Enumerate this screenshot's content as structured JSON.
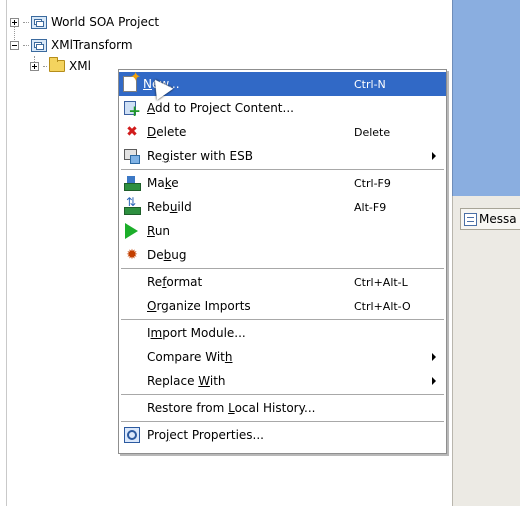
{
  "navigator": {
    "tree": [
      {
        "label": "World SOA Project",
        "expanded": false,
        "icon": "project-icon"
      },
      {
        "label": "XMlTransform",
        "expanded": true,
        "icon": "project-icon"
      },
      {
        "label": "XMl",
        "expanded": false,
        "icon": "folder-icon"
      }
    ]
  },
  "messages_tab": {
    "label": "Messa"
  },
  "context_menu": {
    "items": [
      {
        "icon": "new-icon",
        "pre": "",
        "u": "N",
        "post": "ew...",
        "shortcut": "Ctrl-N",
        "submenu": false,
        "highlighted": true
      },
      {
        "icon": "add-to-project-icon",
        "pre": "",
        "u": "A",
        "post": "dd to Project Content...",
        "shortcut": "",
        "submenu": false
      },
      {
        "icon": "delete-icon",
        "pre": "",
        "u": "D",
        "post": "elete",
        "shortcut": "Delete",
        "submenu": false
      },
      {
        "icon": "register-esb-icon",
        "pre": "Re",
        "u": "g",
        "post": "ister with ESB",
        "shortcut": "",
        "submenu": true
      },
      {
        "separator": true
      },
      {
        "icon": "make-icon",
        "pre": "Ma",
        "u": "k",
        "post": "e",
        "shortcut": "Ctrl-F9",
        "submenu": false
      },
      {
        "icon": "rebuild-icon",
        "pre": "Reb",
        "u": "u",
        "post": "ild",
        "shortcut": "Alt-F9",
        "submenu": false
      },
      {
        "icon": "run-icon",
        "pre": "",
        "u": "R",
        "post": "un",
        "shortcut": "",
        "submenu": false
      },
      {
        "icon": "debug-icon",
        "pre": "De",
        "u": "b",
        "post": "ug",
        "shortcut": "",
        "submenu": false
      },
      {
        "separator": true
      },
      {
        "icon": "",
        "pre": "Re",
        "u": "f",
        "post": "ormat",
        "shortcut": "Ctrl+Alt-L",
        "submenu": false
      },
      {
        "icon": "",
        "pre": "",
        "u": "O",
        "post": "rganize Imports",
        "shortcut": "Ctrl+Alt-O",
        "submenu": false
      },
      {
        "separator": true
      },
      {
        "icon": "",
        "pre": "I",
        "u": "m",
        "post": "port Module...",
        "shortcut": "",
        "submenu": false
      },
      {
        "icon": "",
        "pre": "Compare Wit",
        "u": "h",
        "post": "",
        "shortcut": "",
        "submenu": true
      },
      {
        "icon": "",
        "pre": "Replace ",
        "u": "W",
        "post": "ith",
        "shortcut": "",
        "submenu": true
      },
      {
        "separator": true
      },
      {
        "icon": "",
        "pre": "Restore from ",
        "u": "L",
        "post": "ocal History...",
        "shortcut": "",
        "submenu": false
      },
      {
        "separator": true
      },
      {
        "icon": "project-properties-icon",
        "pre": "Pro",
        "u": "j",
        "post": "ect Properties...",
        "shortcut": "",
        "submenu": false
      }
    ]
  },
  "colors": {
    "highlight": "#3169c6",
    "blue_pane": "#8aaee0"
  }
}
